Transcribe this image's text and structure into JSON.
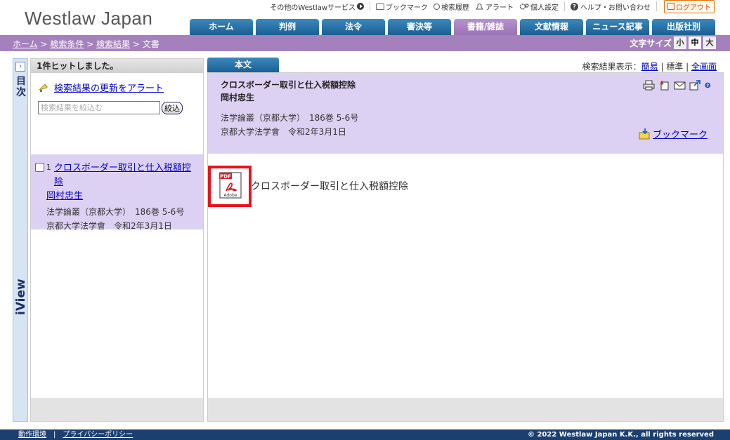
{
  "header": {
    "logo": "Westlaw Japan",
    "util": {
      "other_services": "その他のWestlawサービス",
      "bookmark": "ブックマーク",
      "history": "検索履歴",
      "alert": "アラート",
      "personal": "個人設定",
      "help": "ヘルプ・お問い合わせ",
      "logout": "ログアウト"
    },
    "nav": [
      "ホーム",
      "判例",
      "法令",
      "審決等",
      "書籍/雑誌",
      "文献情報",
      "ニュース記事",
      "出版社別"
    ],
    "active_nav_index": 4
  },
  "breadcrumb": {
    "items": [
      "ホーム",
      "検索条件",
      "検索結果"
    ],
    "separator": " > ",
    "current": "文書"
  },
  "font_size": {
    "label": "文字サイズ",
    "options": [
      "小",
      "中",
      "大"
    ],
    "selected": "中"
  },
  "sidebar": {
    "toc_label": "目次",
    "iview_label": "iView"
  },
  "left_panel": {
    "hits": "1件ヒットしました。",
    "alert_link": "検索結果の更新をアラート",
    "refine_placeholder": "検索結果を絞込む",
    "refine_button": "絞込",
    "result": {
      "number": "1",
      "title": "クロスボーダー取引と仕入税額控除",
      "author": "岡村忠生",
      "source": "法学論叢（京都大学）　186巻 5-6号",
      "publisher": "京都大学法学會　令和2年3月1日"
    }
  },
  "main": {
    "tab": "本文",
    "view_label": "検索結果表示：",
    "view_simple": "簡易",
    "view_standard": "標準",
    "view_full": "全画面",
    "title": "クロスボーダー取引と仕入税額控除",
    "author": "岡村忠生",
    "source": "法学論叢（京都大学）　186巻 5-6号",
    "publisher": "京都大学法学會　令和2年3月1日",
    "bookmark": "ブックマーク",
    "pdf_title": "クロスボーダー取引と仕入税額控除",
    "pdf_badge": "PDF",
    "pdf_brand": "Adobe"
  },
  "footer": {
    "env": "動作環境",
    "privacy": "プライバシーポリシー",
    "copyright": "© 2022 Westlaw Japan K.K., all rights reserved"
  },
  "colors": {
    "nav_blue": "#1c5f93",
    "nav_active": "#9b73b6",
    "crumb_bar": "#a481bd",
    "panel_lavender": "#ddd1f3",
    "pdf_highlight": "#e8121c",
    "footer": "#1b3f6e"
  }
}
